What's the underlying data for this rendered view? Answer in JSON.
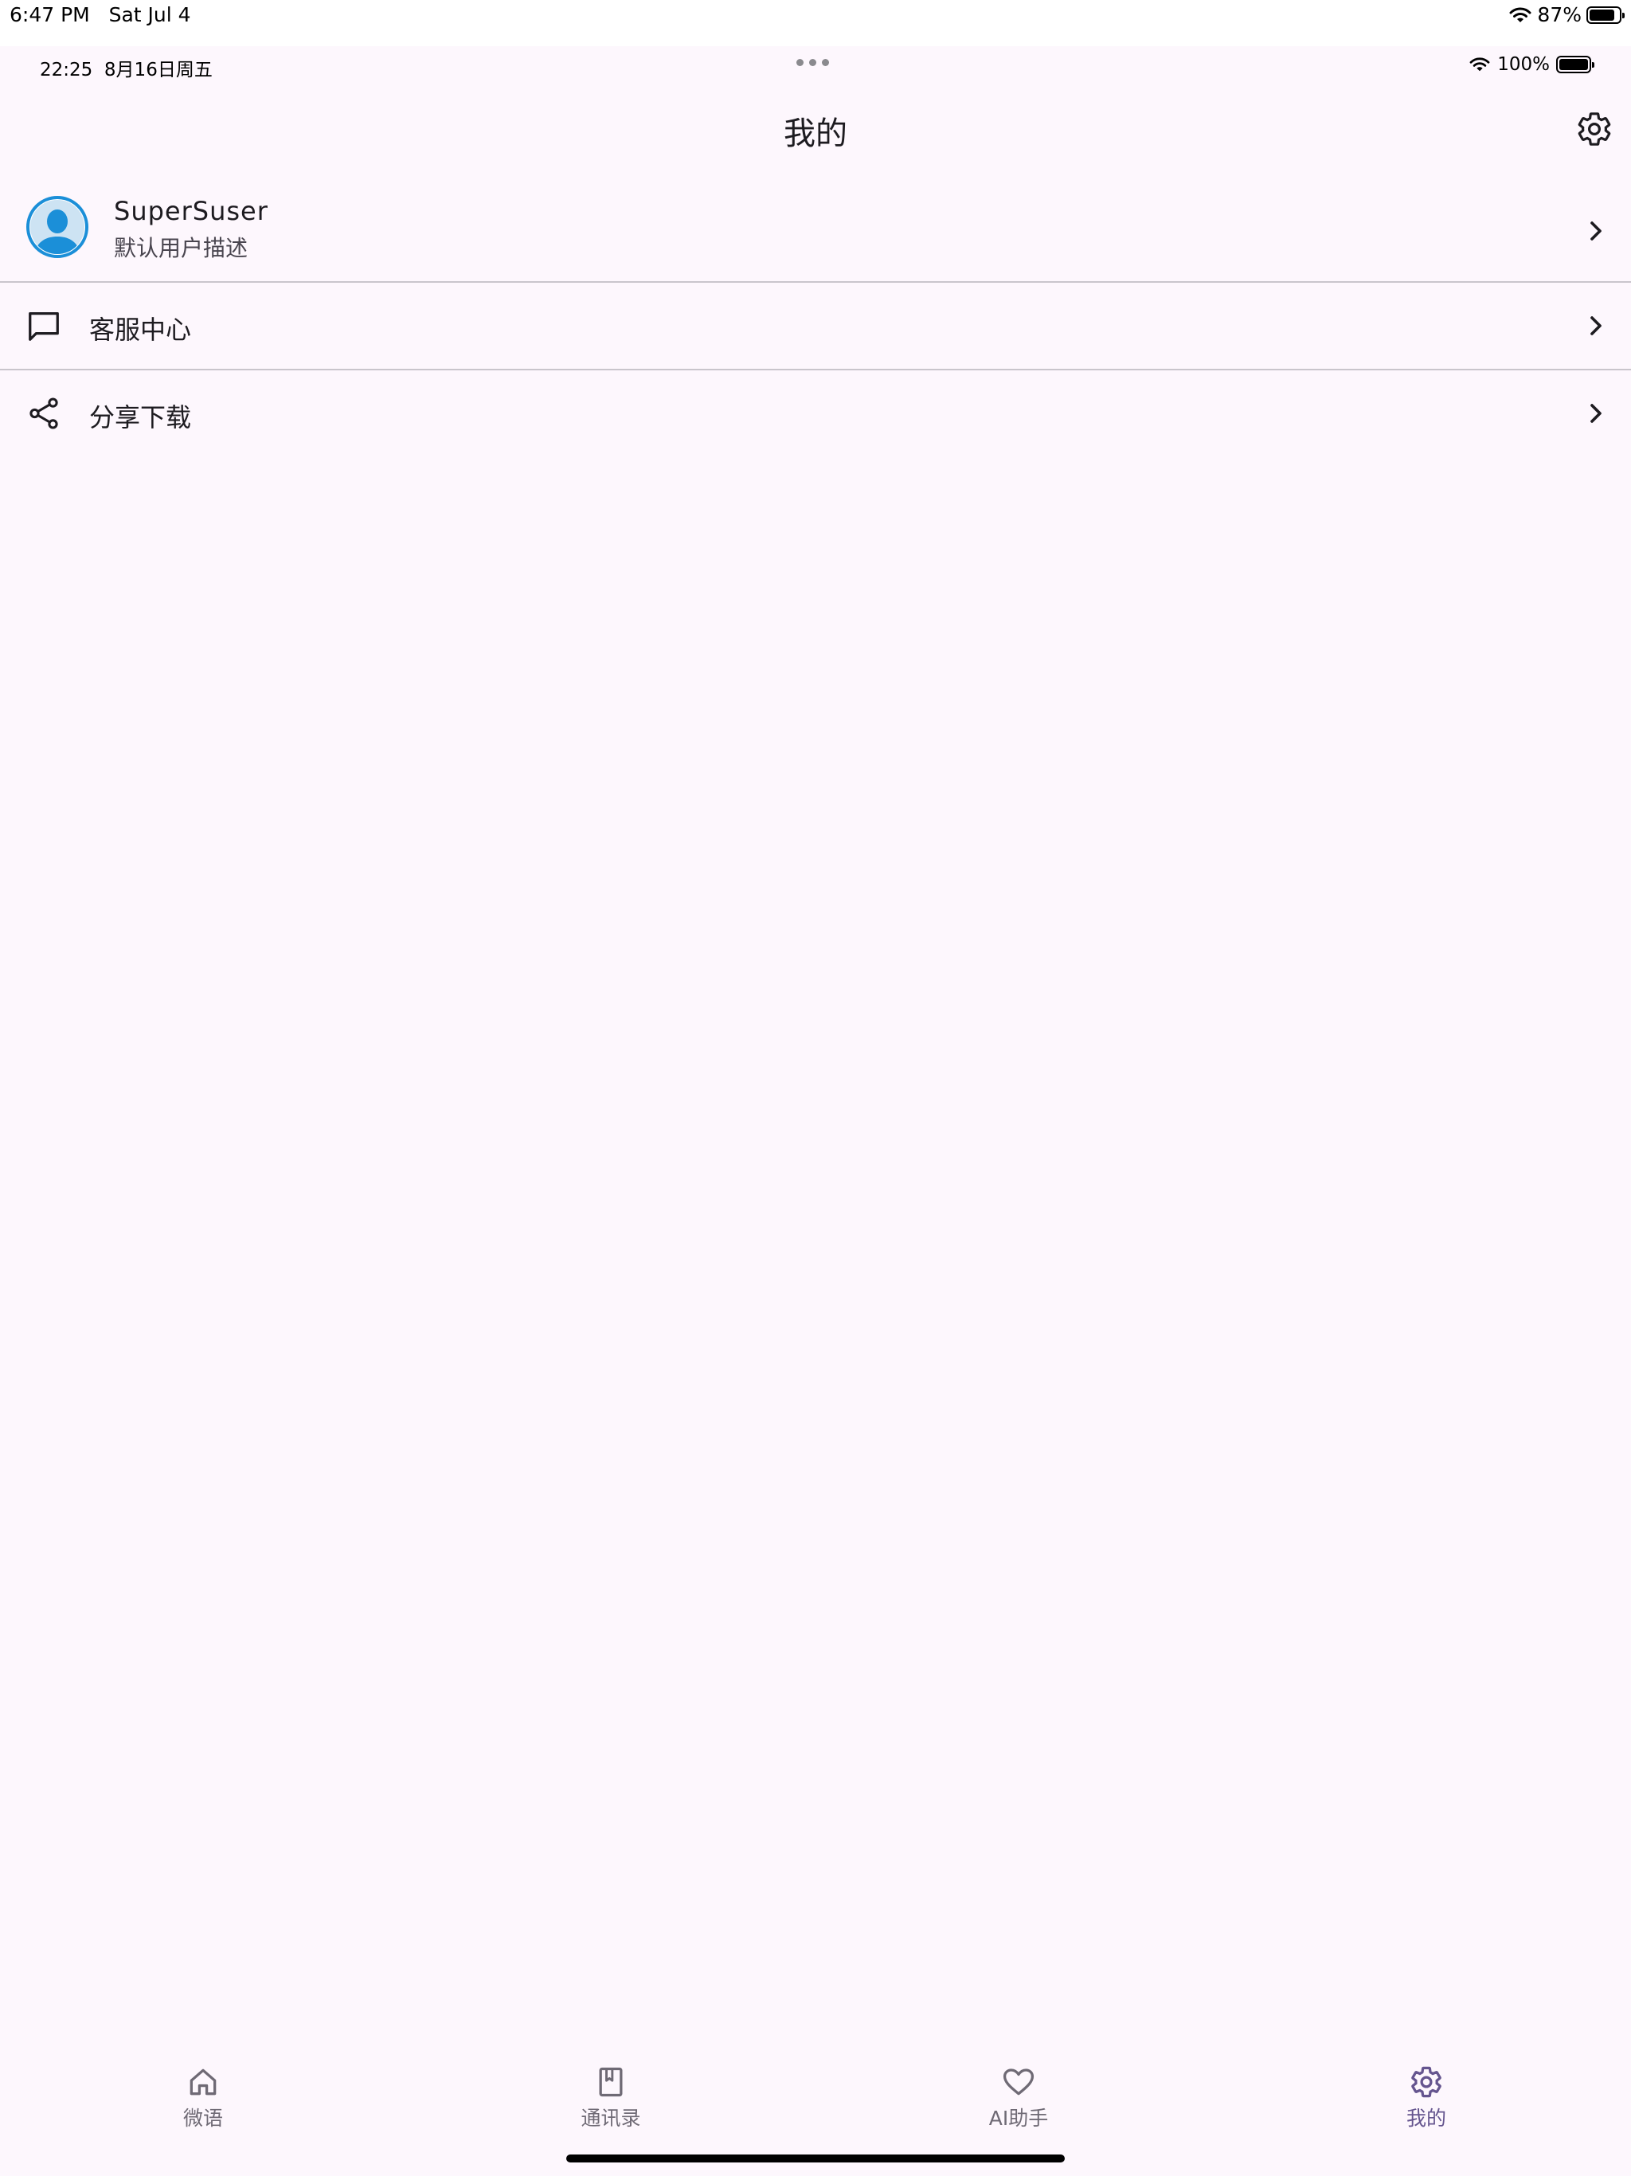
{
  "device_status": {
    "time": "6:47 PM",
    "date": "Sat Jul 4",
    "battery": "87%",
    "battery_level": 0.87
  },
  "app_status": {
    "time": "22:25",
    "date": "8月16日周五",
    "battery": "100%",
    "battery_level": 1.0
  },
  "header": {
    "title": "我的",
    "action_icon": "gear-icon"
  },
  "profile": {
    "name": "SuperSuser",
    "description": "默认用户描述",
    "avatar_icon": "avatar-icon",
    "avatar_color": "#1b8fd8"
  },
  "menu": {
    "items": [
      {
        "label": "客服中心",
        "icon": "chat-bubble-icon"
      },
      {
        "label": "分享下载",
        "icon": "share-icon"
      }
    ]
  },
  "bottom_nav": {
    "items": [
      {
        "label": "微语",
        "icon": "home-icon",
        "active": false
      },
      {
        "label": "通讯录",
        "icon": "contacts-book-icon",
        "active": false
      },
      {
        "label": "AI助手",
        "icon": "heart-icon",
        "active": false
      },
      {
        "label": "我的",
        "icon": "gear-icon",
        "active": true
      }
    ],
    "active_color": "#65558f",
    "inactive_color": "#6f6a75"
  },
  "colors": {
    "background": "#fdf7fd",
    "divider": "#c9c5cc"
  }
}
